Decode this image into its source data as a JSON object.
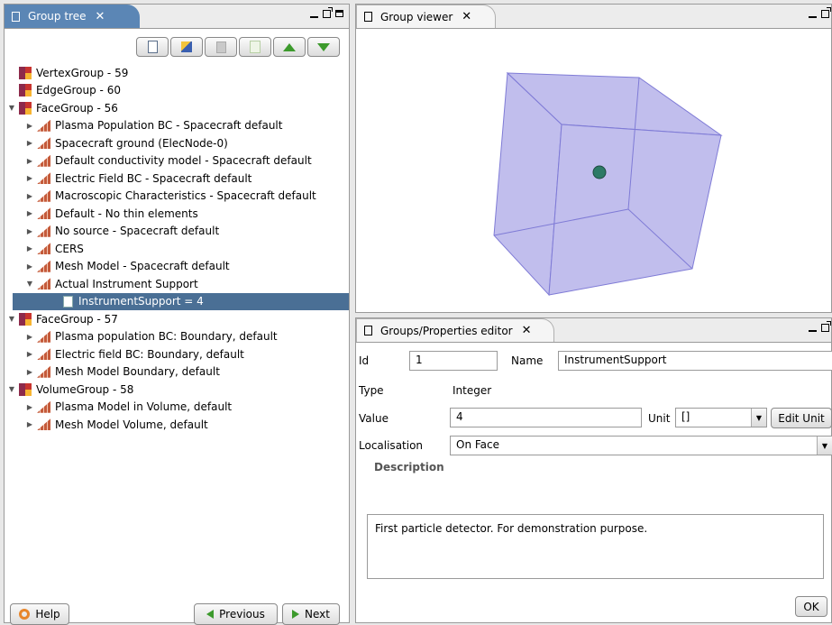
{
  "group_tree": {
    "tab_title": "Group tree",
    "tree": [
      {
        "label": "VertexGroup - 59",
        "icon": "group-icon",
        "indent": 0,
        "disclosure": ""
      },
      {
        "label": "EdgeGroup - 60",
        "icon": "group-icon",
        "indent": 0,
        "disclosure": ""
      },
      {
        "label": "FaceGroup - 56",
        "icon": "group-icon",
        "indent": 0,
        "disclosure": "▼"
      },
      {
        "label": "Plasma Population BC - Spacecraft default",
        "icon": "bricks-icon",
        "indent": 1,
        "disclosure": "▶"
      },
      {
        "label": "Spacecraft ground (ElecNode-0)",
        "icon": "bricks-icon",
        "indent": 1,
        "disclosure": "▶"
      },
      {
        "label": "Default conductivity model - Spacecraft default",
        "icon": "bricks-icon",
        "indent": 1,
        "disclosure": "▶"
      },
      {
        "label": "Electric Field BC - Spacecraft default",
        "icon": "bricks-icon",
        "indent": 1,
        "disclosure": "▶"
      },
      {
        "label": "Macroscopic Characteristics - Spacecraft default",
        "icon": "bricks-icon",
        "indent": 1,
        "disclosure": "▶"
      },
      {
        "label": "Default - No thin elements",
        "icon": "bricks-icon",
        "indent": 1,
        "disclosure": "▶"
      },
      {
        "label": "No source - Spacecraft default",
        "icon": "bricks-icon",
        "indent": 1,
        "disclosure": "▶"
      },
      {
        "label": "CERS",
        "icon": "bricks-icon",
        "indent": 1,
        "disclosure": "▶"
      },
      {
        "label": "Mesh Model - Spacecraft default",
        "icon": "bricks-icon",
        "indent": 1,
        "disclosure": "▶"
      },
      {
        "label": "Actual Instrument Support",
        "icon": "bricks-icon",
        "indent": 1,
        "disclosure": "▼"
      },
      {
        "label": "InstrumentSupport = 4",
        "icon": "doc-icon",
        "indent": 2,
        "disclosure": "",
        "selected": true
      },
      {
        "label": "FaceGroup - 57",
        "icon": "group-icon",
        "indent": 0,
        "disclosure": "▼"
      },
      {
        "label": "Plasma population BC: Boundary, default",
        "icon": "bricks-icon",
        "indent": 1,
        "disclosure": "▶"
      },
      {
        "label": "Electric field BC: Boundary, default",
        "icon": "bricks-icon",
        "indent": 1,
        "disclosure": "▶"
      },
      {
        "label": "Mesh Model Boundary, default",
        "icon": "bricks-icon",
        "indent": 1,
        "disclosure": "▶"
      },
      {
        "label": "VolumeGroup - 58",
        "icon": "group-icon",
        "indent": 0,
        "disclosure": "▼"
      },
      {
        "label": "Plasma Model in Volume, default",
        "icon": "bricks-icon",
        "indent": 1,
        "disclosure": "▶"
      },
      {
        "label": "Mesh Model Volume, default",
        "icon": "bricks-icon",
        "indent": 1,
        "disclosure": "▶"
      }
    ],
    "help_label": "Help",
    "previous_label": "Previous",
    "next_label": "Next"
  },
  "group_viewer": {
    "tab_title": "Group viewer"
  },
  "properties_editor": {
    "tab_title": "Groups/Properties editor",
    "id_label": "Id",
    "id_value": "1",
    "name_label": "Name",
    "name_value": "InstrumentSupport",
    "type_label": "Type",
    "type_value": "Integer",
    "value_label": "Value",
    "value_value": "4",
    "unit_label": "Unit",
    "unit_value": "[]",
    "edit_unit_label": "Edit Unit",
    "localisation_label": "Localisation",
    "localisation_value": "On Face",
    "description_header": "Description",
    "description_text": "First particle detector. For demonstration purpose.",
    "ok_label": "OK"
  },
  "colors": {
    "selection": "#4a6f95",
    "active_tab": "#5b86b5",
    "cube_fill": "#b6b3ea",
    "cube_edge": "#7f7bd6"
  }
}
